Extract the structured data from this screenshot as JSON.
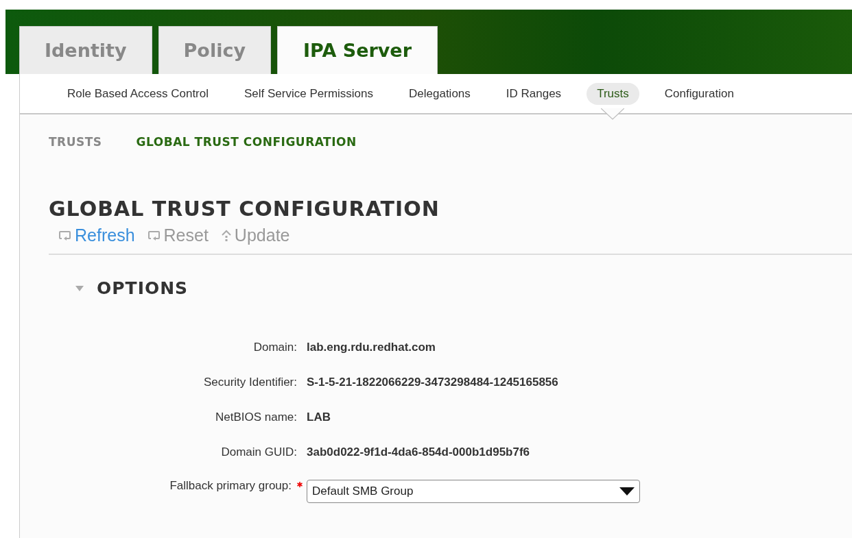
{
  "tabs": [
    {
      "label": "Identity",
      "selected": false
    },
    {
      "label": "Policy",
      "selected": false
    },
    {
      "label": "IPA Server",
      "selected": true
    }
  ],
  "subnav": [
    {
      "label": "Role Based Access Control",
      "selected": false
    },
    {
      "label": "Self Service Permissions",
      "selected": false
    },
    {
      "label": "Delegations",
      "selected": false
    },
    {
      "label": "ID Ranges",
      "selected": false
    },
    {
      "label": "Trusts",
      "selected": true
    },
    {
      "label": "Configuration",
      "selected": false
    }
  ],
  "breadcrumb": [
    {
      "label": "TRUSTS",
      "selected": false
    },
    {
      "label": "GLOBAL TRUST CONFIGURATION",
      "selected": true
    }
  ],
  "title": "GLOBAL TRUST CONFIGURATION",
  "actions": [
    {
      "label": "Refresh",
      "kind": "refresh",
      "disabled": false
    },
    {
      "label": "Reset",
      "kind": "reset",
      "disabled": true
    },
    {
      "label": "Update",
      "kind": "update",
      "disabled": true
    }
  ],
  "section": {
    "title": "OPTIONS",
    "expanded": true,
    "fields": [
      {
        "label": "Domain:",
        "kind": "text",
        "value": "lab.eng.rdu.redhat.com"
      },
      {
        "label": "Security Identifier:",
        "kind": "text",
        "value": "S-1-5-21-1822066229-3473298484-1245165856"
      },
      {
        "label": "NetBIOS name:",
        "kind": "text",
        "value": "LAB"
      },
      {
        "label": "Domain GUID:",
        "kind": "text",
        "value": "3ab0d022-9f1d-4da6-854d-000b1d95b7f6"
      },
      {
        "label": "Fallback primary group:",
        "kind": "select",
        "value": "Default SMB Group",
        "required": true
      }
    ]
  }
}
